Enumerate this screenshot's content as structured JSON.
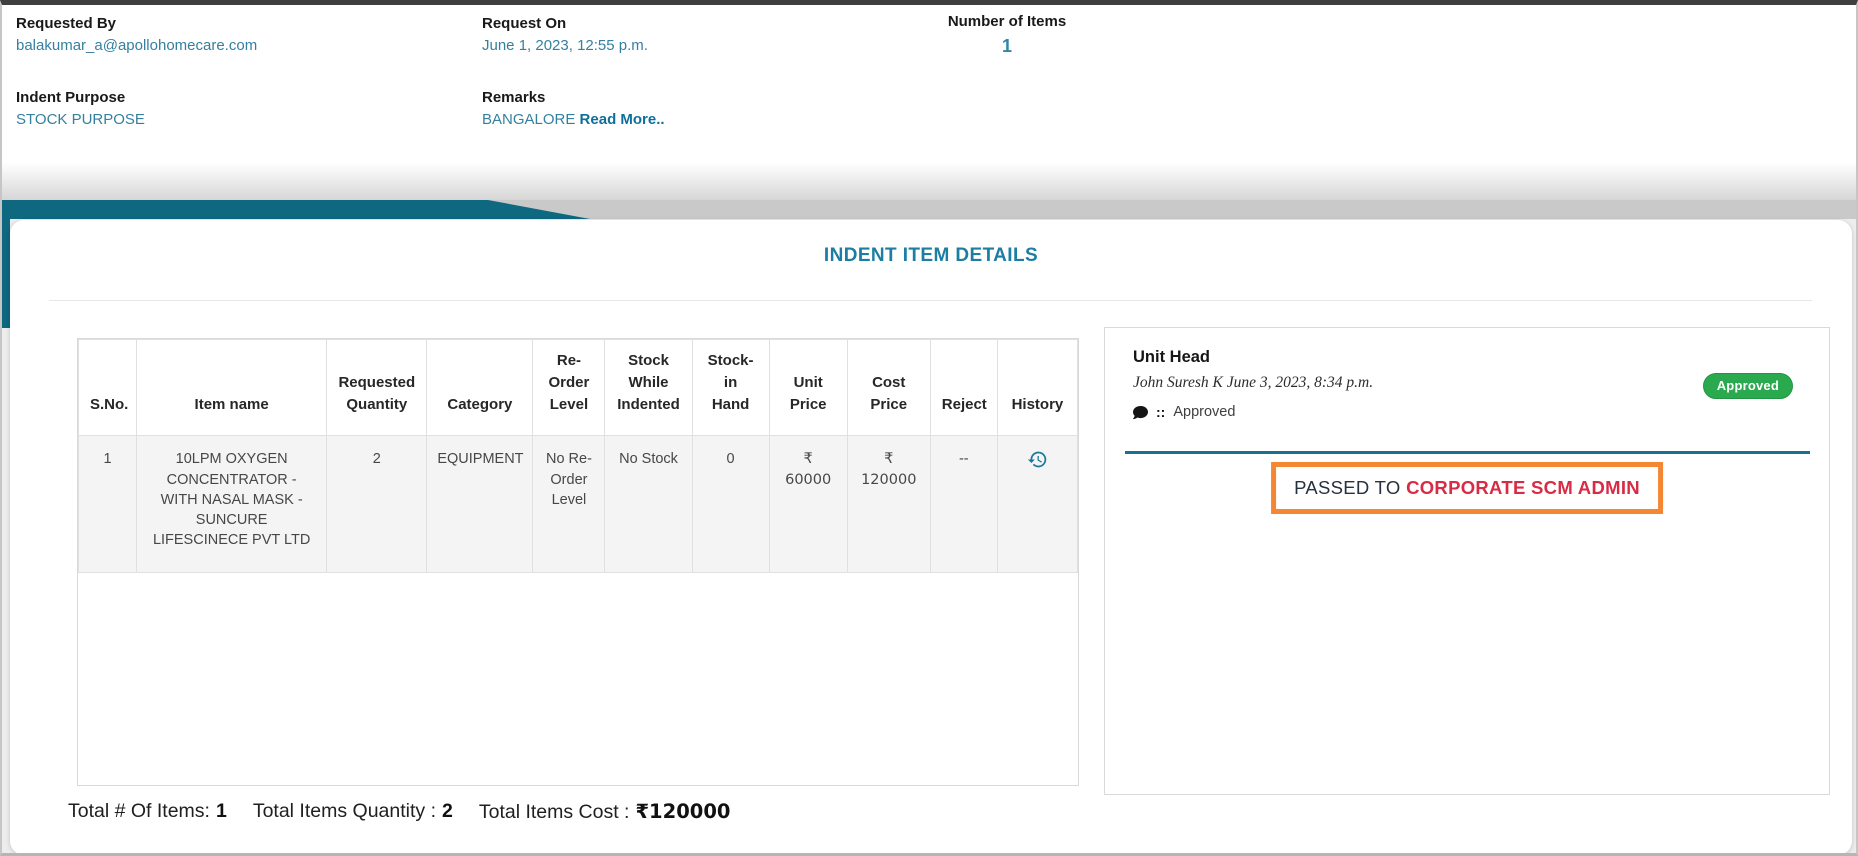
{
  "summary": {
    "requested_by": {
      "label": "Requested By",
      "value": "balakumar_a@apollohomecare.com"
    },
    "request_on": {
      "label": "Request On",
      "value": "June 1, 2023, 12:55 p.m."
    },
    "number_of_items": {
      "label": "Number of Items",
      "value": "1"
    },
    "indent_purpose": {
      "label": "Indent Purpose",
      "value": "STOCK PURPOSE"
    },
    "remarks": {
      "label": "Remarks",
      "value": "BANGALORE",
      "read_more": "Read More.."
    }
  },
  "details": {
    "title": "INDENT ITEM DETAILS",
    "columns": [
      "S.No.",
      "Item name",
      "Requested Quantity",
      "Category",
      "Re-Order Level",
      "Stock While Indented",
      "Stock-in Hand",
      "Unit Price",
      "Cost Price",
      "Reject",
      "History"
    ],
    "row": {
      "sno": "1",
      "item_name": "10LPM OXYGEN CONCENTRATOR - WITH NASAL MASK - SUNCURE LIFESCINECE PVT LTD",
      "requested_quantity": "2",
      "category": "EQUIPMENT",
      "reorder_level": "No Re-Order Level",
      "stock_while_indented": "No Stock",
      "stock_in_hand": "0",
      "unit_price_currency": "₹",
      "unit_price": "60000",
      "cost_price_currency": "₹",
      "cost_price": "120000",
      "reject": "--"
    },
    "totals": {
      "items_label": "Total # Of Items:",
      "items_value": "1",
      "quantity_label": "Total Items Quantity :",
      "quantity_value": "2",
      "cost_label": "Total Items Cost :",
      "cost_value": "₹120000"
    }
  },
  "approval": {
    "role": "Unit Head",
    "approver_meta": "John Suresh K June 3, 2023, 8:34 p.m.",
    "status_badge": "Approved",
    "comment_separator": "::",
    "comment": "Approved",
    "passed_prefix": "PASSED TO",
    "passed_target": "CORPORATE SCM ADMIN"
  },
  "colors": {
    "accent_teal": "#1b7ea2",
    "band_teal": "#0d6880",
    "link_teal": "#35809f",
    "badge_green": "#2ba94f",
    "alert_orange": "#f58634",
    "alert_red": "#d92b45"
  }
}
